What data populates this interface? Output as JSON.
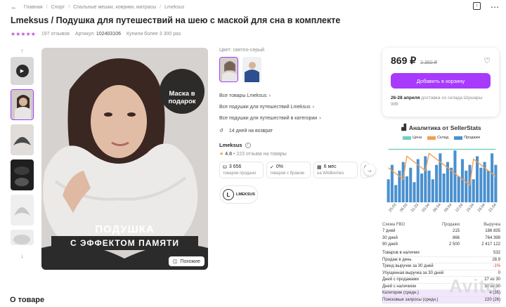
{
  "breadcrumbs": [
    "Главная",
    "Спорт",
    "Спальные мешки, коврики, матрасы",
    "Lmeksus"
  ],
  "title": "Lmeksus / Подушка для путешествий на шею с маской для сна в комплекте",
  "meta": {
    "reviews": "197 отзывов",
    "article_label": "Артикул:",
    "article": "102403106",
    "bought": "Купили более 3 300 раз"
  },
  "main_image": {
    "badge": "Маска в подарок",
    "promo_line1": "ПОДУШКА",
    "promo_line2": "С ЭФФЕКТОМ ПАМЯТИ",
    "similar_label": "Похожие"
  },
  "info": {
    "color_label": "Цвет: светло-серый",
    "links": [
      "Все товары Lmeksus",
      "Все подушки для путешествий Lmeksus",
      "Все подушки для путешествий в категории"
    ],
    "return": "14 дней на возврат",
    "brand": "Lmeksus",
    "brand_rating": "4.8",
    "brand_reviews": "• 223 отзыва на товары",
    "stats": [
      {
        "value": "3 656",
        "label": "товаров продано"
      },
      {
        "value": "0%",
        "label": "товаров с браком"
      },
      {
        "value": "6 мес",
        "label": "на Wildberries"
      }
    ],
    "logo_text": "LMEKSUS"
  },
  "price": {
    "current": "869 ₽",
    "old": "2 350 ₽",
    "cart_button": "Добавить в корзину",
    "delivery_date": "26-28 апреля",
    "delivery_text": "доставка со склада Шушары WB"
  },
  "sellerstats": {
    "title": "Аналитика от SellerStats",
    "legend": [
      "Цена",
      "Склад",
      "Продажи"
    ],
    "colors": {
      "price": "#6fd0c0",
      "stock": "#f0a050",
      "sales": "#4a90d0"
    },
    "chart_data": {
      "type": "bar",
      "x_labels": [
        "25.03",
        "28.03",
        "31.03",
        "03.04",
        "06.04",
        "09.04",
        "12.04",
        "15.04",
        "18.04",
        "21.04"
      ],
      "sales": [
        40,
        65,
        30,
        55,
        70,
        45,
        60,
        35,
        75,
        50,
        80,
        55,
        40,
        65,
        85,
        50,
        70,
        60,
        90,
        45,
        75,
        55,
        65,
        40,
        80,
        60,
        70,
        55,
        85,
        65
      ],
      "stock": [
        60,
        55,
        50,
        45,
        40,
        80,
        75,
        70,
        65,
        60,
        55,
        85,
        80,
        75,
        70,
        65,
        60,
        55,
        50,
        45,
        40,
        35,
        30,
        75,
        70,
        65,
        60,
        55,
        50,
        45
      ],
      "price": [
        92,
        92,
        92,
        92,
        92,
        92,
        92,
        92,
        92,
        92,
        92,
        92,
        92,
        92,
        92,
        92,
        92,
        92,
        92,
        92,
        92,
        92,
        92,
        92,
        92,
        92,
        92,
        92,
        92,
        92
      ]
    },
    "table_header": [
      "Схема FBO",
      "Продажи",
      "Выручка"
    ],
    "table_rows": [
      [
        "7 дней",
        "215",
        "186 835"
      ],
      [
        "30 дней",
        "866",
        "764 398"
      ],
      [
        "90 дней",
        "2 500",
        "2 417 122"
      ]
    ],
    "list": [
      [
        "Товаров в наличии",
        "532"
      ],
      [
        "Продаж в день",
        "28.9"
      ],
      [
        "Тренд выручки за 30 дней",
        "-1%"
      ],
      [
        "Упущенная выручка за 30 дней",
        "0"
      ],
      [
        "Дней с продажами",
        "27 из 30"
      ],
      [
        "Дней с наличием",
        "30 из 30"
      ],
      [
        "Категории (средн.)",
        "4 (35)"
      ],
      [
        "Поисковые запросы (средн.)",
        "220 (26)"
      ]
    ]
  },
  "about_title": "О товаре",
  "watermark": "Avito"
}
